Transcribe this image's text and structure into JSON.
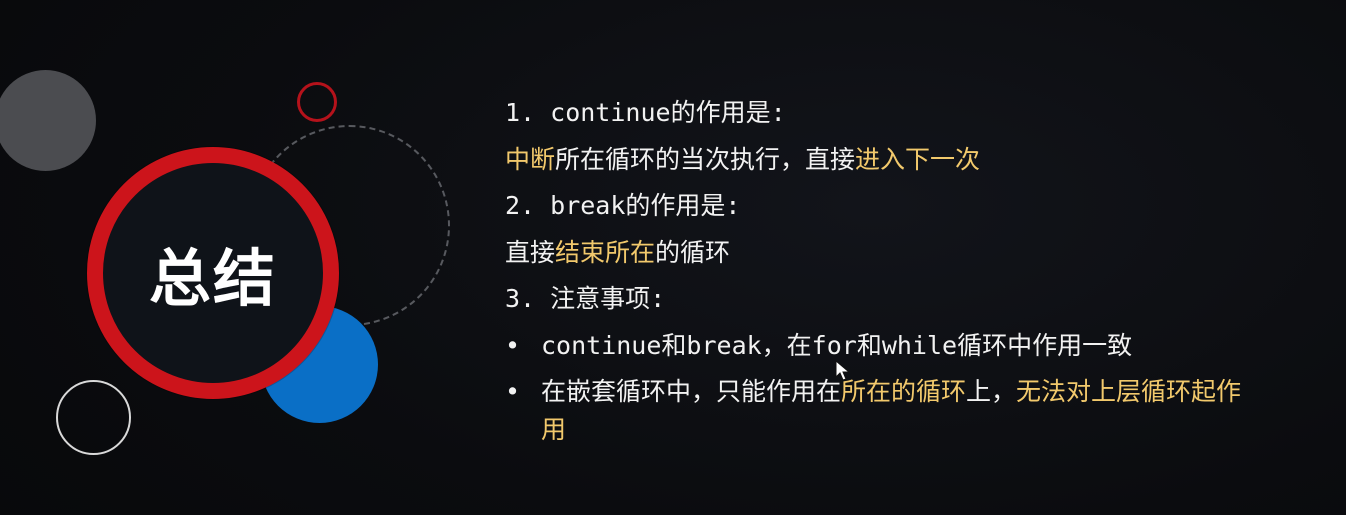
{
  "slide": {
    "title": "总结",
    "points": {
      "p1": {
        "heading": "1. continue的作用是:",
        "desc_parts": [
          {
            "text": "中断",
            "highlight": true
          },
          {
            "text": "所在循环的当次执行，直接",
            "highlight": false
          },
          {
            "text": "进入下一次",
            "highlight": true
          }
        ]
      },
      "p2": {
        "heading": "2. break的作用是:",
        "desc_parts": [
          {
            "text": "直接",
            "highlight": false
          },
          {
            "text": "结束所在",
            "highlight": true
          },
          {
            "text": "的循环",
            "highlight": false
          }
        ]
      },
      "p3": {
        "heading": "3. 注意事项:"
      }
    },
    "bullets": [
      {
        "symbol": "•",
        "parts": [
          {
            "text": "continue和break，在for和while循环中作用一致",
            "highlight": false
          }
        ]
      },
      {
        "symbol": "•",
        "parts": [
          {
            "text": "在嵌套循环中，只能作用在",
            "highlight": false
          },
          {
            "text": "所在的循环",
            "highlight": true
          },
          {
            "text": "上，",
            "highlight": false
          },
          {
            "text": "无法对上层循环起作用",
            "highlight": true
          }
        ]
      }
    ]
  },
  "colors": {
    "background": "#0b0c0f",
    "text": "#f2f2f2",
    "highlight": "#f2c96c",
    "title_ring": "#cc141b",
    "blue_circle": "#0a6fc6",
    "gray_circle": "#4b4c50"
  },
  "icons": {
    "cursor": "mouse-pointer-icon"
  }
}
